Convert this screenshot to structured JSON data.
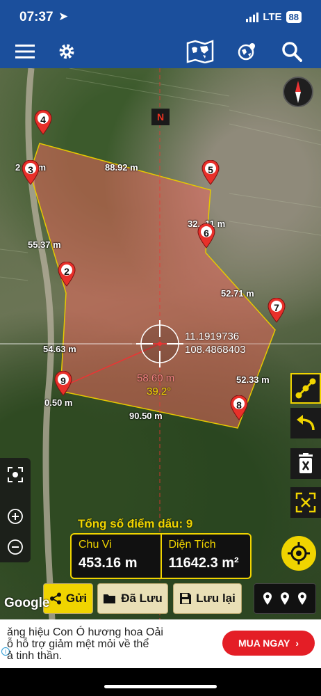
{
  "status": {
    "time": "07:37",
    "network": "LTE",
    "battery": "88"
  },
  "topbar": {
    "menu_icon": "menu-icon",
    "settings_icon": "gear-icon",
    "map_icon": "world-map-icon",
    "layers_icon": "globe-pin-icon",
    "search_icon": "search-icon"
  },
  "map": {
    "north_label": "N",
    "markers": [
      "2",
      "3",
      "4",
      "5",
      "6",
      "7",
      "8",
      "9"
    ],
    "edge_lengths": {
      "e_4_3": "2    3 m",
      "e_4_5": "88.92 m",
      "e_5_6": "32.  11 m",
      "e_3_2": "55.37 m",
      "e_6_7": "52.71 m",
      "e_2_9": "54.63 m",
      "e_7_8": "52.33 m",
      "e_9_1": "0.50 m",
      "e_8_9": "90.50 m"
    },
    "center_lat": "11.1919736",
    "center_lon": "108.4868403",
    "distance": "58.60 m",
    "bearing": "39.2°"
  },
  "summary": {
    "total_label": "Tổng số điểm dấu: 9",
    "perimeter_label": "Chu Vi",
    "perimeter_value": "453.16 m",
    "area_label": "Diện Tích",
    "area_value": "11642.3 m²"
  },
  "actions": {
    "send": "Gửi",
    "saved": "Đã Lưu",
    "save": "Lưu lại"
  },
  "google": "Google",
  "ad": {
    "text_line1": "ǎng hiệu Con Ó hương hoa Oải",
    "text_line2": "ỗ hỗ trợ giảm mệt mỏi về thể",
    "text_line3": "ả tinh thần.",
    "button": "MUA NGAY",
    "info": "i"
  }
}
